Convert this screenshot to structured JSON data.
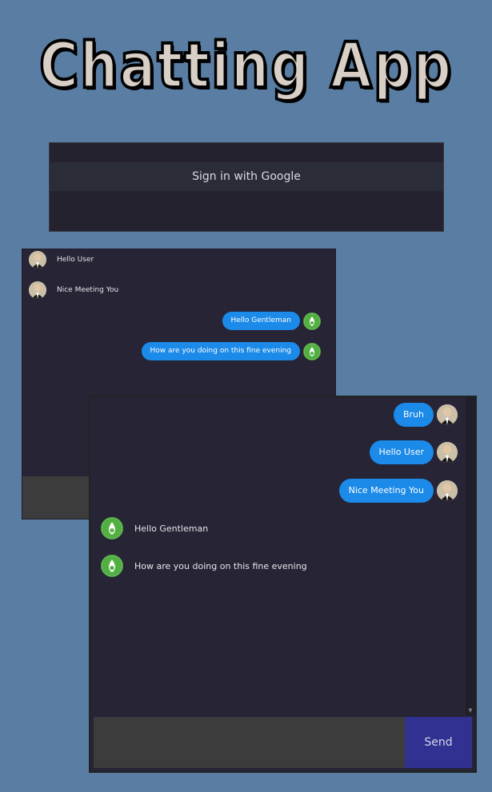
{
  "title": "Chatting App",
  "signin": {
    "button_label": "Sign in with Google"
  },
  "chat1": {
    "messages": [
      {
        "side": "left",
        "avatar": "gentleman-avatar-icon",
        "text": "Hello User"
      },
      {
        "side": "left",
        "avatar": "gentleman-avatar-icon",
        "text": "Nice Meeting You"
      },
      {
        "side": "right",
        "avatar": "green-leaf-avatar-icon",
        "text": "Hello Gentleman"
      },
      {
        "side": "right",
        "avatar": "green-leaf-avatar-icon",
        "text": "How are you doing on this fine evening"
      }
    ]
  },
  "chat2": {
    "messages": [
      {
        "side": "right",
        "avatar": "gentleman-avatar-icon",
        "text": "Bruh"
      },
      {
        "side": "right",
        "avatar": "gentleman-avatar-icon",
        "text": "Hello User"
      },
      {
        "side": "right",
        "avatar": "gentleman-avatar-icon",
        "text": "Nice Meeting You"
      },
      {
        "side": "left",
        "avatar": "green-leaf-avatar-icon",
        "text": "Hello Gentleman"
      },
      {
        "side": "left",
        "avatar": "green-leaf-avatar-icon",
        "text": "How are you doing on this fine evening"
      }
    ],
    "send_label": "Send"
  },
  "colors": {
    "background": "#5a7ea3",
    "panel": "#262435",
    "bubble": "#1b8ae8",
    "send": "#303190"
  }
}
